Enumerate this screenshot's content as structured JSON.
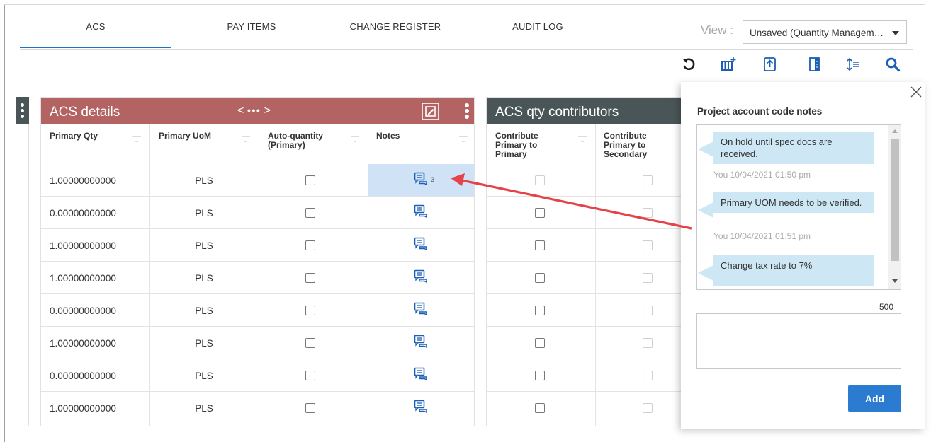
{
  "tabs": [
    {
      "label": "ACS",
      "active": true
    },
    {
      "label": "PAY ITEMS",
      "active": false
    },
    {
      "label": "CHANGE REGISTER",
      "active": false
    },
    {
      "label": "AUDIT LOG",
      "active": false
    }
  ],
  "view": {
    "label": "View :",
    "selected": "Unsaved (Quantity Managem…"
  },
  "toolbar": {
    "icons": [
      "refresh-icon",
      "add-column-icon",
      "export-icon",
      "column-chooser-icon",
      "row-height-icon",
      "search-icon"
    ]
  },
  "acs_details": {
    "title": "ACS details",
    "nav_prefix": "<",
    "nav_suffix": ">",
    "columns": [
      "Primary Qty",
      "Primary UoM",
      "Auto-quantity (Primary)",
      "Notes"
    ],
    "rows": [
      {
        "qty": "1.00000000000",
        "uom": "PLS",
        "note_count": "3"
      },
      {
        "qty": "0.00000000000",
        "uom": "PLS",
        "note_count": ""
      },
      {
        "qty": "1.00000000000",
        "uom": "PLS",
        "note_count": ""
      },
      {
        "qty": "1.00000000000",
        "uom": "PLS",
        "note_count": ""
      },
      {
        "qty": "0.00000000000",
        "uom": "PLS",
        "note_count": ""
      },
      {
        "qty": "1.00000000000",
        "uom": "PLS",
        "note_count": ""
      },
      {
        "qty": "0.00000000000",
        "uom": "PLS",
        "note_count": ""
      },
      {
        "qty": "1.00000000000",
        "uom": "PLS",
        "note_count": ""
      }
    ]
  },
  "acs_contributors": {
    "title": "ACS qty contributors",
    "columns": [
      "Contribute Primary to Primary",
      "Contribute Primary to Secondary"
    ]
  },
  "notes_panel": {
    "title": "Project account code notes",
    "notes": [
      {
        "text": "On hold until spec docs are received.",
        "meta": "You 10/04/2021 01:50 pm"
      },
      {
        "text": "Primary UOM needs to be verified.",
        "meta": "You 10/04/2021 01:51 pm"
      },
      {
        "text": "Change tax rate to 7%",
        "meta": ""
      }
    ],
    "char_limit": "500",
    "textarea_value": "",
    "add_label": "Add"
  },
  "colors": {
    "acs_header": "#b36462",
    "contributors_header": "#4a5557",
    "accent": "#1a73c9",
    "arrow": "#e5434a",
    "bubble": "#cde7f4",
    "selected_cell": "#cfe2f6"
  }
}
